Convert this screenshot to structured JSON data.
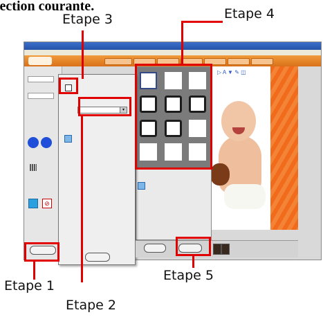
{
  "header": {
    "caption": "lection courante."
  },
  "steps": {
    "step1": "Etape 1",
    "step2": "Etape 2",
    "step3": "Etape 3",
    "step4": "Etape 4",
    "step5": "Etape 5"
  },
  "colors": {
    "callout": "#e00000",
    "toolbar": "#e07f24",
    "accent_blue": "#1f4fd8"
  },
  "icons": [
    "blue-circle-icon",
    "blue-square-icon",
    "red-close-icon",
    "texture-thumbnail-icon",
    "checkbox-icon"
  ]
}
